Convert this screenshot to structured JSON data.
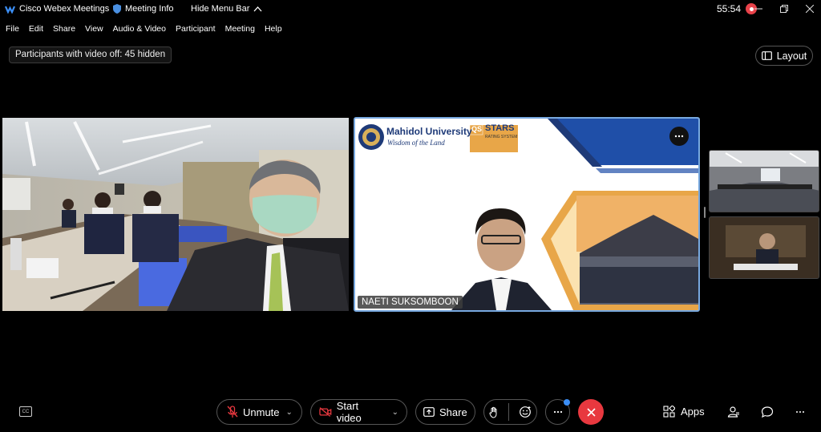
{
  "titlebar": {
    "app_title": "Cisco Webex Meetings",
    "meeting_info": "Meeting Info",
    "hide_menu": "Hide Menu Bar",
    "timer": "55:54"
  },
  "menu": [
    "File",
    "Edit",
    "Share",
    "View",
    "Audio & Video",
    "Participant",
    "Meeting",
    "Help"
  ],
  "hidden_notice": "Participants with video off: 45 hidden",
  "layout_label": "Layout",
  "tiles": {
    "active_speaker_name": "NAETI SUKSOMBOON",
    "slide": {
      "university": "Mahidol University",
      "motto": "Wisdom of the Land",
      "qs_stars": "STARS",
      "qs_rating": "RATING SYSTEM",
      "qs_prefix": "QS"
    }
  },
  "controls": {
    "unmute": "Unmute",
    "start_video": "Start video",
    "share": "Share",
    "apps": "Apps"
  },
  "colors": {
    "accent_border": "#78a9e0",
    "leave": "#e8383f",
    "record": "#e8424a",
    "notification": "#3b8ef5"
  }
}
